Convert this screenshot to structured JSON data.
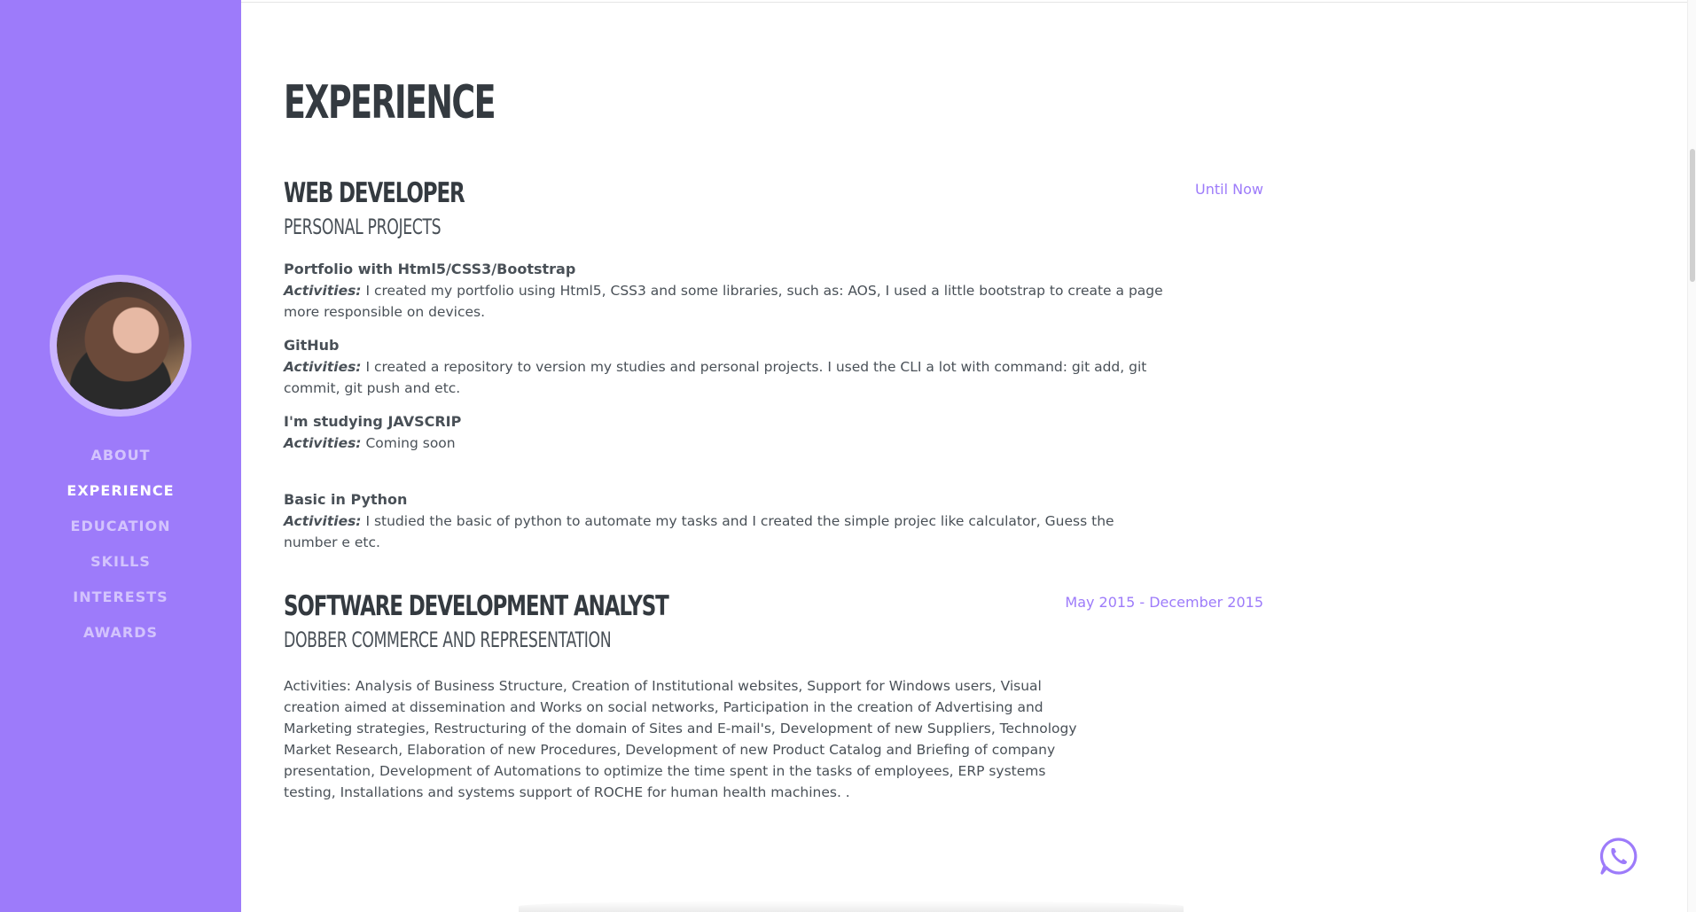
{
  "nav": {
    "items": [
      "ABOUT",
      "EXPERIENCE",
      "EDUCATION",
      "SKILLS",
      "INTERESTS",
      "AWARDS"
    ],
    "active": "EXPERIENCE"
  },
  "section": {
    "title": "EXPERIENCE"
  },
  "jobs": [
    {
      "title": "WEB DEVELOPER",
      "subtitle": "PERSONAL PROJECTS",
      "date": "Until Now",
      "items": [
        {
          "title": "Portfolio with Html5/CSS3/Bootstrap",
          "label": "Activities:",
          "text": " I created my portfolio using Html5, CSS3 and some libraries, such as: AOS, I used a little bootstrap to create a page more responsible on devices."
        },
        {
          "title": "GitHub",
          "label": "Activities:",
          "text": " I created a repository to version my studies and personal projects. I used the CLI a lot with command: git add, git commit, git push and etc."
        },
        {
          "title": "I'm studying JAVSCRIP",
          "label": "Activities:",
          "text": " Coming soon"
        },
        {
          "title": "Basic in Python",
          "label": "Activities:",
          "text": " I studied the basic of python to automate my tasks and I created the simple projec like calculator, Guess the number e etc."
        }
      ]
    },
    {
      "title": "SOFTWARE DEVELOPMENT ANALYST",
      "subtitle": "DOBBER COMMERCE AND REPRESENTATION",
      "date": "May 2015 - December 2015",
      "paragraph": "Activities: Analysis of Business Structure, Creation of Institutional websites, Support for Windows users, Visual creation aimed at dissemination and Works on social networks, Participation in the creation of Advertising and Marketing strategies, Restructuring of the domain of Sites and E-mail's, Development of new Suppliers, Technology Market Research, Elaboration of new Procedures, Development of new Product Catalog and Briefing of company presentation, Development of Automations to optimize the time spent in the tasks of employees, ERP systems testing, Installations and systems support of ROCHE for human health machines. ."
    }
  ],
  "colors": {
    "accent": "#9d7bfa",
    "heading": "#343a40",
    "text": "#495057"
  },
  "icons": {
    "floating": "whatsapp-icon"
  }
}
